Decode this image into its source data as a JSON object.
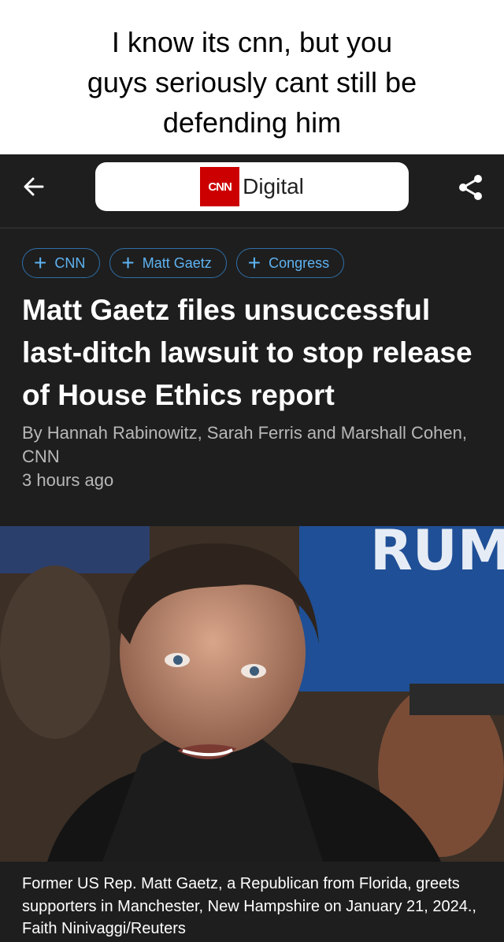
{
  "meme": {
    "caption_lines": [
      "I know its cnn, but you",
      "guys seriously cant still be",
      "defending him"
    ]
  },
  "topbar": {
    "logo_text": "CNN",
    "site_label": "Digital",
    "icons": [
      "arrow-left-icon",
      "share-icon"
    ]
  },
  "tags": [
    {
      "label": "CNN"
    },
    {
      "label": "Matt Gaetz"
    },
    {
      "label": "Congress"
    }
  ],
  "article": {
    "headline": "Matt Gaetz files unsuccessful last-ditch lawsuit to stop release of House Ethics report",
    "byline": "By Hannah Rabinowitz, Sarah Ferris and Marshall Cohen, CNN",
    "timestamp": "3 hours ago",
    "photo_caption": "Former US Rep. Matt Gaetz, a Republican from Florida, greets supporters in Manchester, New Hampshire on January 21, 2024., Faith Ninivaggi/Reuters"
  },
  "colors": {
    "accent": "#5eb3f2",
    "cnn_red": "#cc0000",
    "background": "#1e1e1e"
  }
}
